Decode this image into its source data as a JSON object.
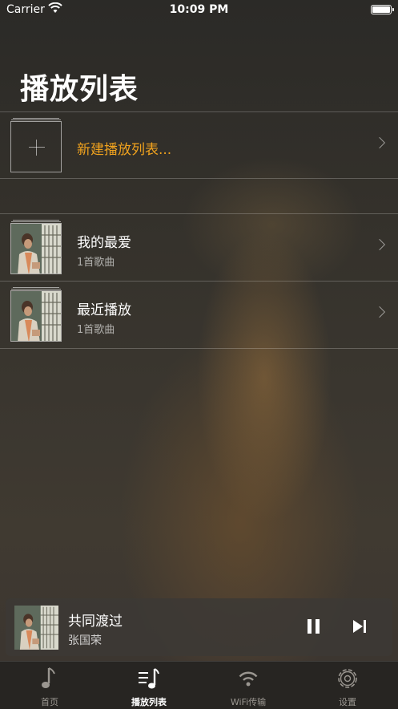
{
  "status_bar": {
    "carrier": "Carrier",
    "time": "10:09 PM"
  },
  "page_title": "播放列表",
  "new_playlist": {
    "label": "新建播放列表..."
  },
  "playlists": [
    {
      "name": "我的最爱",
      "count": "1首歌曲"
    },
    {
      "name": "最近播放",
      "count": "1首歌曲"
    }
  ],
  "now_playing": {
    "song": "共同渡过",
    "artist": "张国荣"
  },
  "tabs": [
    {
      "label": "首页",
      "icon": "music-note-icon"
    },
    {
      "label": "播放列表",
      "icon": "playlist-icon"
    },
    {
      "label": "WiFi传输",
      "icon": "wifi-icon"
    },
    {
      "label": "设置",
      "icon": "gear-icon"
    }
  ],
  "colors": {
    "accent": "#f0a21e",
    "text": "#ffffff"
  }
}
